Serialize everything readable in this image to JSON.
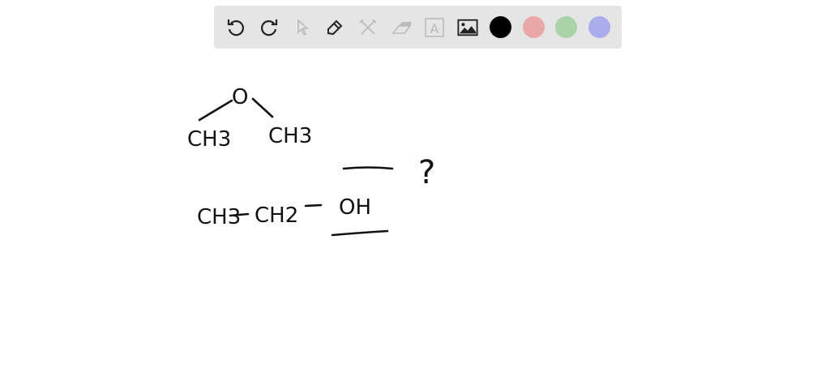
{
  "toolbar": {
    "tools": [
      {
        "name": "undo",
        "icon": "undo-icon",
        "enabled": true
      },
      {
        "name": "redo",
        "icon": "redo-icon",
        "enabled": true
      },
      {
        "name": "select",
        "icon": "cursor-icon",
        "enabled": false
      },
      {
        "name": "pen",
        "icon": "pencil-icon",
        "enabled": true
      },
      {
        "name": "tools",
        "icon": "tools-icon",
        "enabled": false
      },
      {
        "name": "eraser",
        "icon": "eraser-icon",
        "enabled": false
      },
      {
        "name": "text",
        "icon": "text-icon",
        "label": "A",
        "enabled": false
      },
      {
        "name": "image",
        "icon": "image-icon",
        "enabled": true
      }
    ],
    "colors": [
      "#000000",
      "#e9a7a7",
      "#aad3aa",
      "#abacec"
    ]
  },
  "canvas": {
    "oxygen": "O",
    "left_methyl": "CH3",
    "right_methyl": "CH3",
    "ethanol_ch3": "CH3",
    "ethanol_ch2": "CH2",
    "ethanol_oh": "OH",
    "question_mark": "?"
  }
}
